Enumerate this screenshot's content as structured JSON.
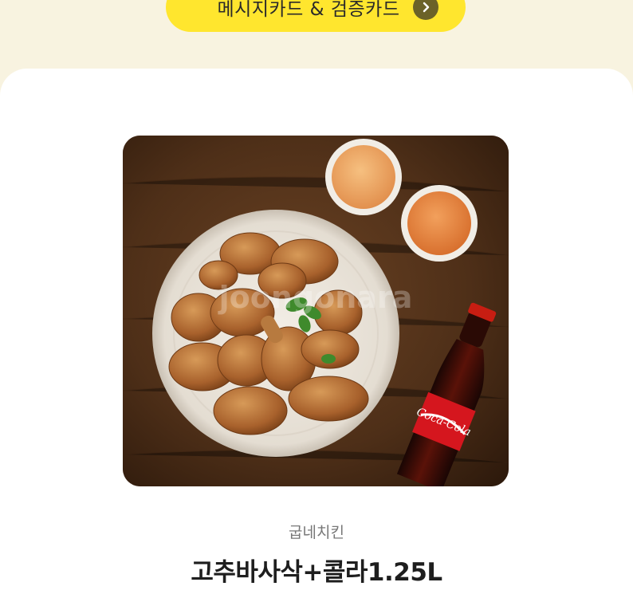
{
  "top_button": {
    "label": "메시지카드 & 검증카드",
    "icon": "chevron-right-icon",
    "color": "#ffe62e"
  },
  "product": {
    "brand": "굽네치킨",
    "name": "고추바사삭+콜라1.25L",
    "image_watermark": "joongonara",
    "bottle_label": "Coca-Cola"
  },
  "colors": {
    "page_background": "#f8f3e0",
    "card_background": "#ffffff"
  }
}
